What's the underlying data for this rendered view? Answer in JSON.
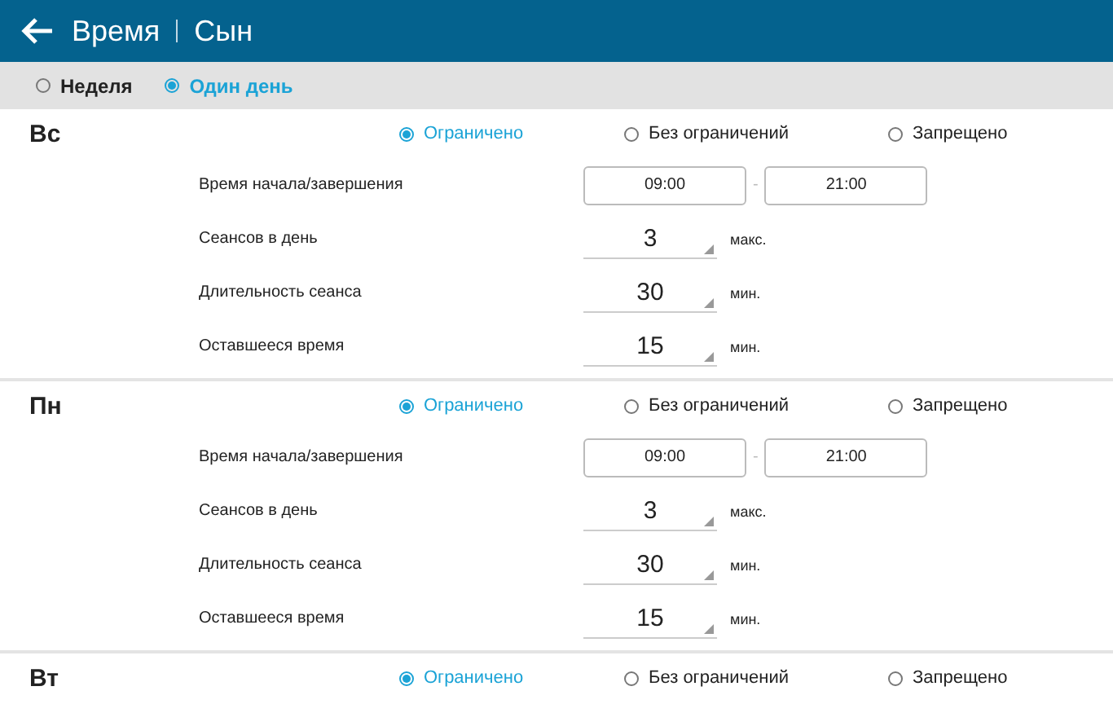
{
  "header": {
    "title": "Время",
    "subtitle": "Сын"
  },
  "modes": [
    {
      "label": "Неделя",
      "selected": false
    },
    {
      "label": "Один день",
      "selected": true
    }
  ],
  "days": [
    {
      "name": "Вс",
      "options": [
        {
          "label": "Ограничено",
          "selected": true
        },
        {
          "label": "Без ограничений",
          "selected": false
        },
        {
          "label": "Запрещено",
          "selected": false
        }
      ],
      "time_range": {
        "label": "Время начала/завершения",
        "start": "09:00",
        "separator": "-",
        "end": "21:00"
      },
      "settings": [
        {
          "label": "Сеансов в день",
          "value": "3",
          "unit": "макс."
        },
        {
          "label": "Длительность сеанса",
          "value": "30",
          "unit": "мин."
        },
        {
          "label": "Оставшееся время",
          "value": "15",
          "unit": "мин."
        }
      ]
    },
    {
      "name": "Пн",
      "options": [
        {
          "label": "Ограничено",
          "selected": true
        },
        {
          "label": "Без ограничений",
          "selected": false
        },
        {
          "label": "Запрещено",
          "selected": false
        }
      ],
      "time_range": {
        "label": "Время начала/завершения",
        "start": "09:00",
        "separator": "-",
        "end": "21:00"
      },
      "settings": [
        {
          "label": "Сеансов в день",
          "value": "3",
          "unit": "макс."
        },
        {
          "label": "Длительность сеанса",
          "value": "30",
          "unit": "мин."
        },
        {
          "label": "Оставшееся время",
          "value": "15",
          "unit": "мин."
        }
      ]
    },
    {
      "name": "Вт",
      "options": [
        {
          "label": "Ограничено",
          "selected": true
        },
        {
          "label": "Без ограничений",
          "selected": false
        },
        {
          "label": "Запрещено",
          "selected": false
        }
      ]
    }
  ]
}
